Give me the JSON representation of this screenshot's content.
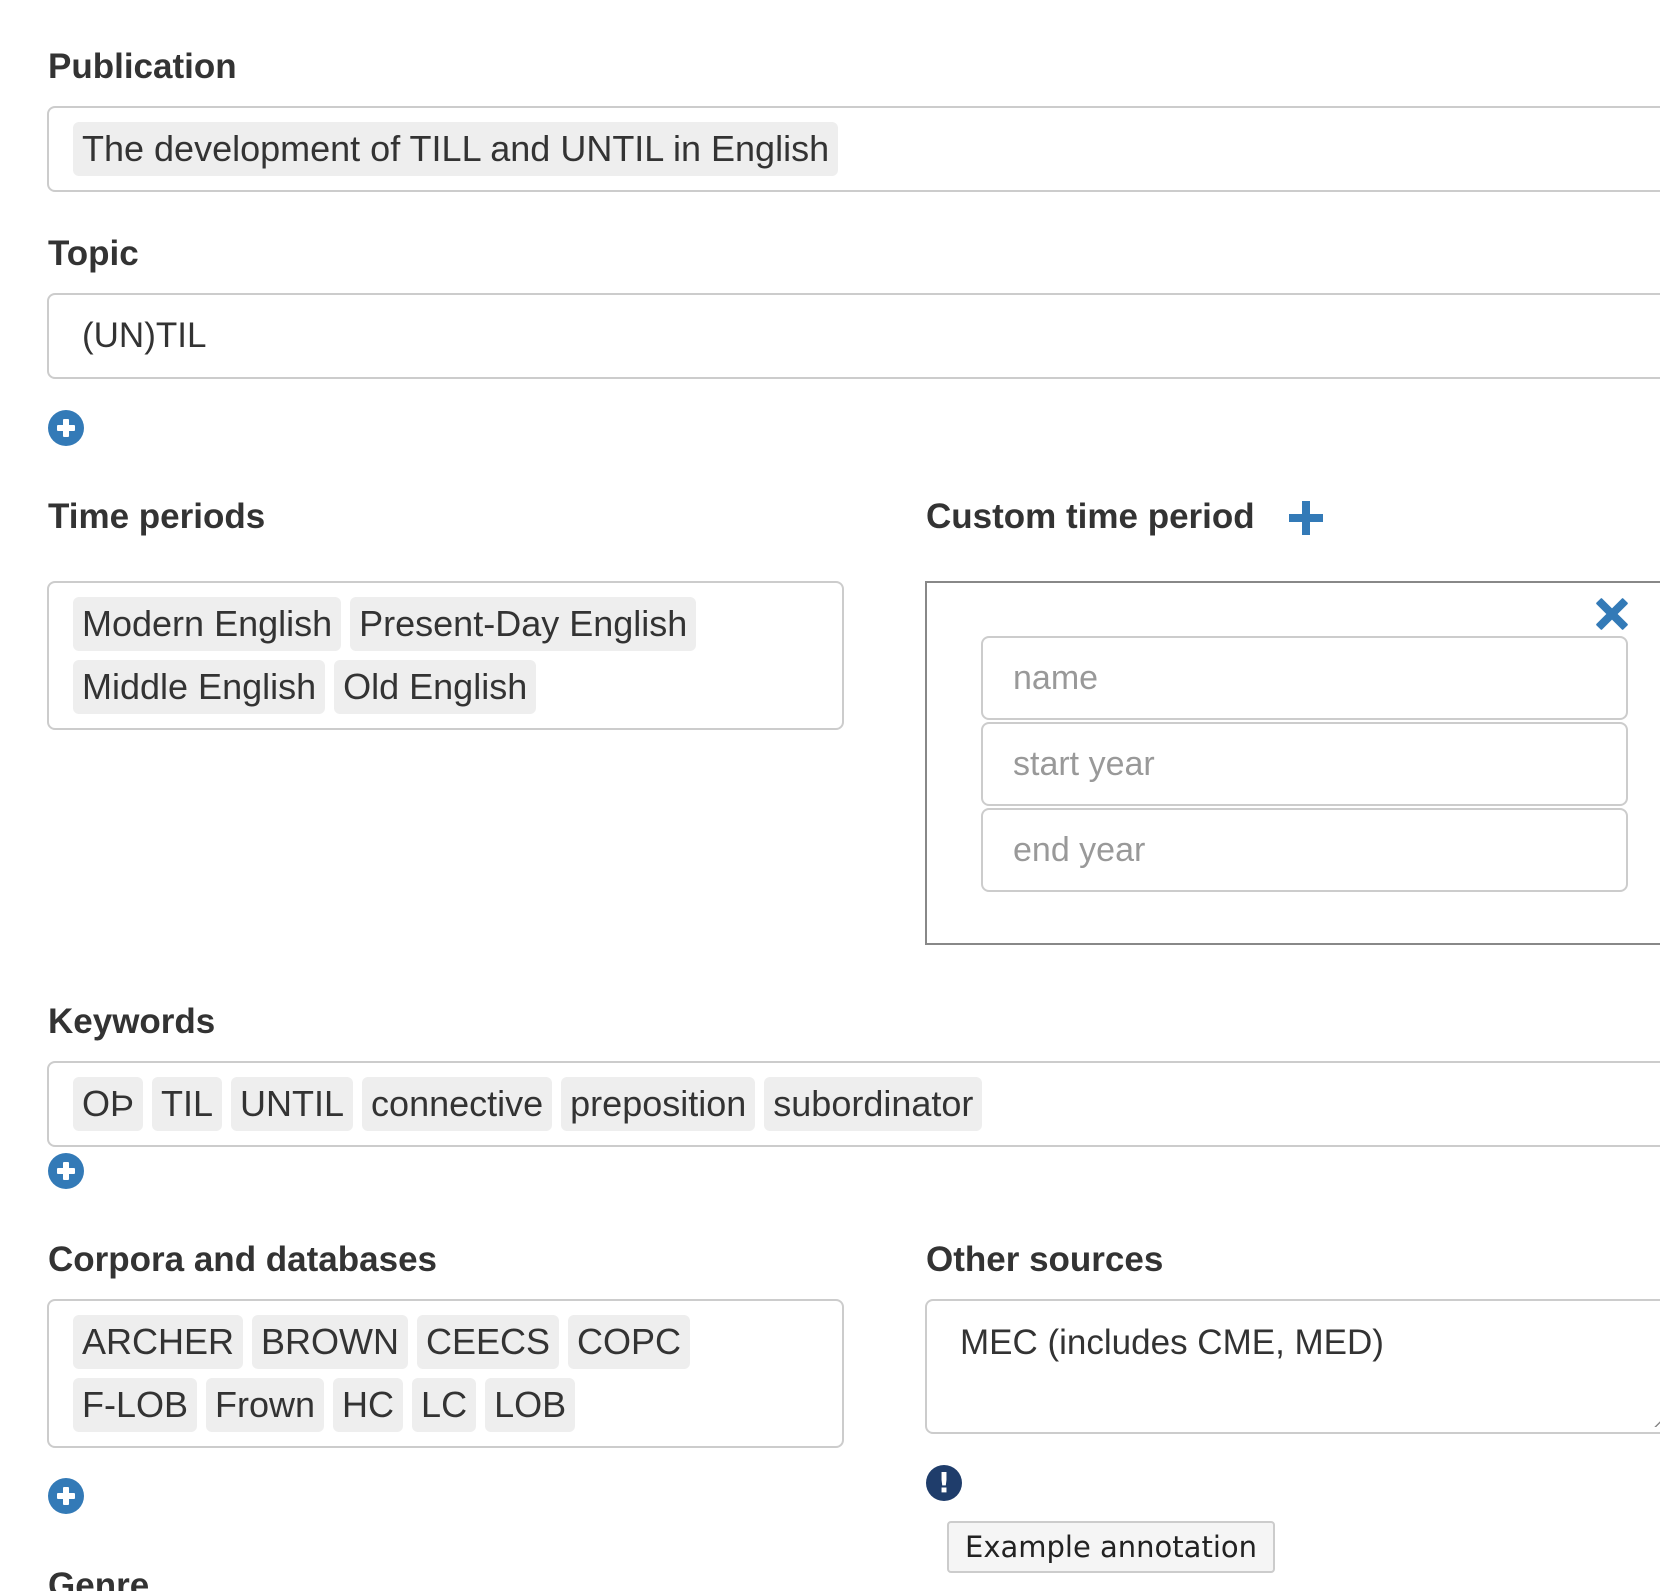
{
  "publication": {
    "label": "Publication",
    "tags": [
      "The development of TILL and UNTIL in English"
    ]
  },
  "topic": {
    "label": "Topic",
    "value": "(UN)TIL"
  },
  "time_periods": {
    "label": "Time periods",
    "tags": [
      "Modern English",
      "Present-Day English",
      "Middle English",
      "Old English"
    ]
  },
  "custom_time_period": {
    "label": "Custom time period",
    "name_placeholder": "name",
    "start_placeholder": "start year",
    "end_placeholder": "end year"
  },
  "keywords": {
    "label": "Keywords",
    "tags": [
      "OÞ",
      "TIL",
      "UNTIL",
      "connective",
      "preposition",
      "subordinator"
    ]
  },
  "corpora": {
    "label": "Corpora and databases",
    "tags": [
      "ARCHER",
      "BROWN",
      "CEECS",
      "COPC",
      "F-LOB",
      "Frown",
      "HC",
      "LC",
      "LOB"
    ]
  },
  "other_sources": {
    "label": "Other sources",
    "value": "MEC (includes CME, MED)",
    "example_button": "Example annotation"
  },
  "genre": {
    "label": "Genre"
  },
  "colors": {
    "accent": "#337ab7",
    "dark_accent": "#1f3d6b",
    "tag_bg": "#eeeeee",
    "border": "#cccccc"
  },
  "icons": {
    "add": "plus-circle-icon",
    "custom_add": "plus-icon",
    "remove": "close-icon",
    "info": "exclamation-circle-icon"
  }
}
